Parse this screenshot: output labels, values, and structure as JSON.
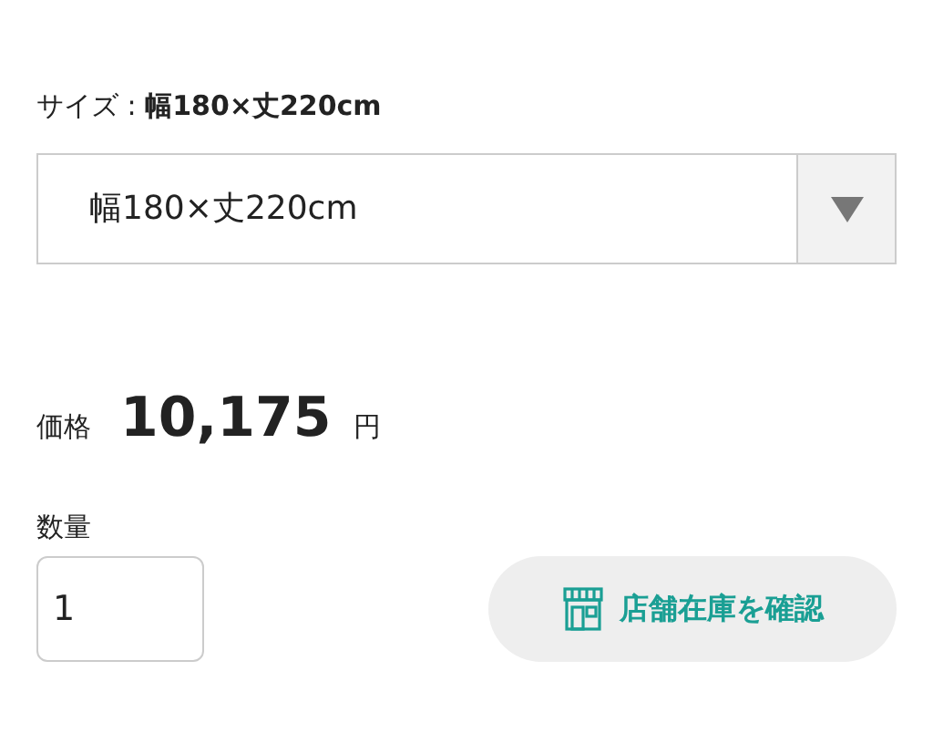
{
  "size_label": "サイズ : **幅180×丈220cm**",
  "size_select": {
    "value": "幅180×丈220cm"
  },
  "price": {
    "label": "価格",
    "amount": "10,175",
    "unit": "円"
  },
  "quantity": {
    "label": "数量",
    "value": "1"
  },
  "stock_button": {
    "label": "店舗在庫を確認"
  }
}
